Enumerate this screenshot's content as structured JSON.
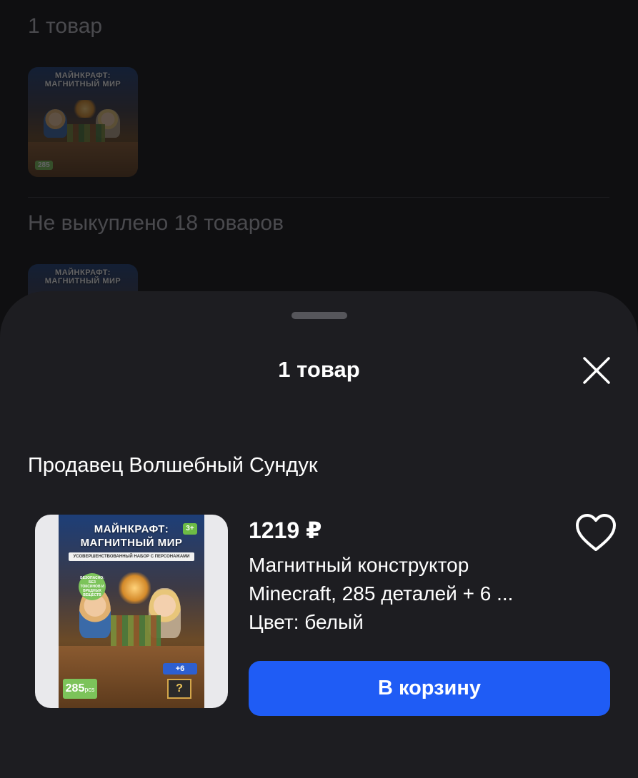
{
  "background": {
    "section1_title": "1 товар",
    "section2_title": "Не выкуплено 18 товаров"
  },
  "sheet": {
    "title": "1 товар",
    "close_icon": "close-icon",
    "seller_label": "Продавец Волшебный Сундук"
  },
  "product": {
    "price": "1219 ₽",
    "name_line1": "Магнитный конструктор",
    "name_line2": "Minecraft, 285 деталей + 6 ...",
    "color": "Цвет: белый",
    "favorite_icon": "heart-icon",
    "cart_button_label": "В корзину",
    "image": {
      "title_line1": "МАЙНКРАФТ:",
      "title_line2": "МАГНИТНЫЙ МИР",
      "age": "3+",
      "subtitle": "УСОВЕРШЕНСТВОВАННЫЙ НАБОР С ПЕРСОНАЖАМИ",
      "safety": "БЕЗОПАСНО: БЕЗ ТОКСИНОВ И ВРЕДНЫХ ВЕЩЕСТВ",
      "count_big": "285",
      "count_unit": "pcs",
      "bonus": "+6",
      "chest_mark": "?"
    }
  },
  "colors": {
    "accent_button": "#1f5cf5",
    "sheet_bg": "#1d1d21",
    "page_bg": "#0f0f11"
  }
}
